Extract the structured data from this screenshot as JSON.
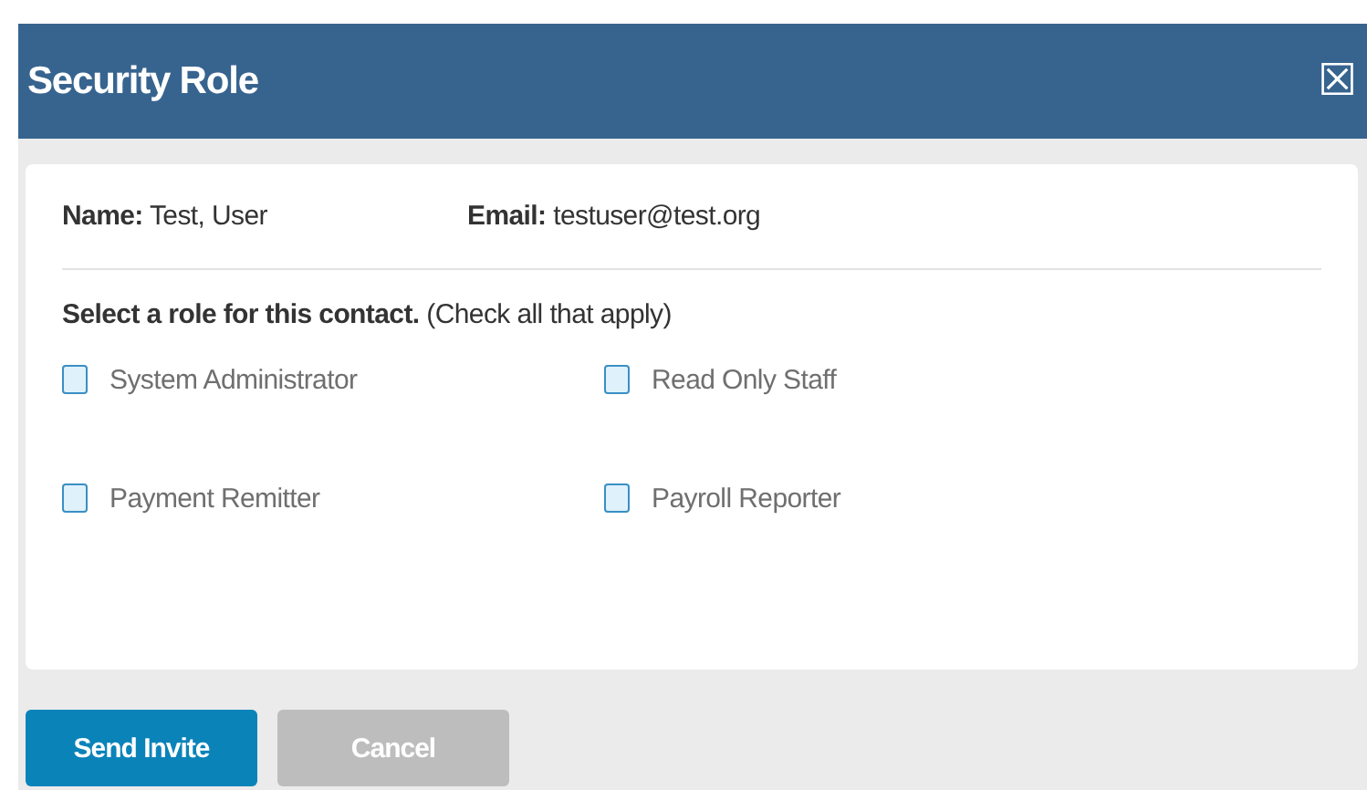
{
  "window": {
    "title": "Security Role",
    "close_icon": "☒"
  },
  "contact": [
    {
      "text": "**Name:** Test, User"
    },
    {
      "text": "**Email:** testuser@test.org"
    }
  ],
  "instruction": "**Select a role for this contact.** (Check all that apply)",
  "roles": [
    {
      "label": "System Administrator",
      "checked": false
    },
    {
      "label": "Read Only Staff",
      "checked": false
    },
    {
      "label": "Payment Remitter",
      "checked": false
    },
    {
      "label": "Payroll Reporter",
      "checked": false
    }
  ],
  "buttons": [
    {
      "label": "Send Invite",
      "disabled": false
    },
    {
      "label": "Cancel",
      "disabled": true
    }
  ]
}
